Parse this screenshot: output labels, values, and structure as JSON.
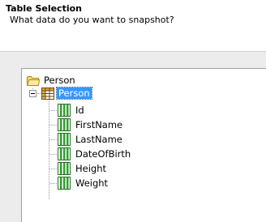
{
  "header": {
    "title": "Table Selection",
    "description": "What data do you want to snapshot?"
  },
  "tree": {
    "root": {
      "label": "Person",
      "icon": "folder-icon"
    },
    "table": {
      "label": "Person",
      "icon": "table-icon",
      "selected": true,
      "expanded": true
    },
    "columns": [
      {
        "label": "Id",
        "icon": "column-icon"
      },
      {
        "label": "FirstName",
        "icon": "column-icon"
      },
      {
        "label": "LastName",
        "icon": "column-icon"
      },
      {
        "label": "DateOfBirth",
        "icon": "column-icon"
      },
      {
        "label": "Height",
        "icon": "column-icon"
      },
      {
        "label": "Weight",
        "icon": "column-icon"
      }
    ]
  },
  "colors": {
    "selection": "#3399ff",
    "panel_bg": "#ececec"
  }
}
